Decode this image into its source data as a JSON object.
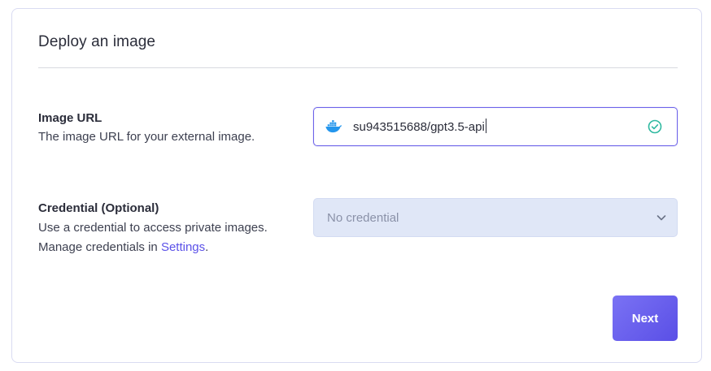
{
  "header": {
    "title": "Deploy an image"
  },
  "image_url": {
    "label": "Image URL",
    "description": "The image URL for your external image.",
    "value": "su943515688/gpt3.5-api",
    "icon": "docker-icon",
    "status_icon": "check-circle-icon"
  },
  "credential": {
    "label": "Credential (Optional)",
    "description_line1": "Use a credential to access private images.",
    "description_line2_prefix": "Manage credentials in ",
    "settings_link": "Settings",
    "description_line2_suffix": ".",
    "selected": "No credential",
    "icon": "chevron-down-icon"
  },
  "actions": {
    "next_label": "Next"
  },
  "colors": {
    "accent": "#5b51e8",
    "success": "#2fb9a0",
    "select_bg": "#e0e7f7",
    "docker": "#2496ed"
  }
}
